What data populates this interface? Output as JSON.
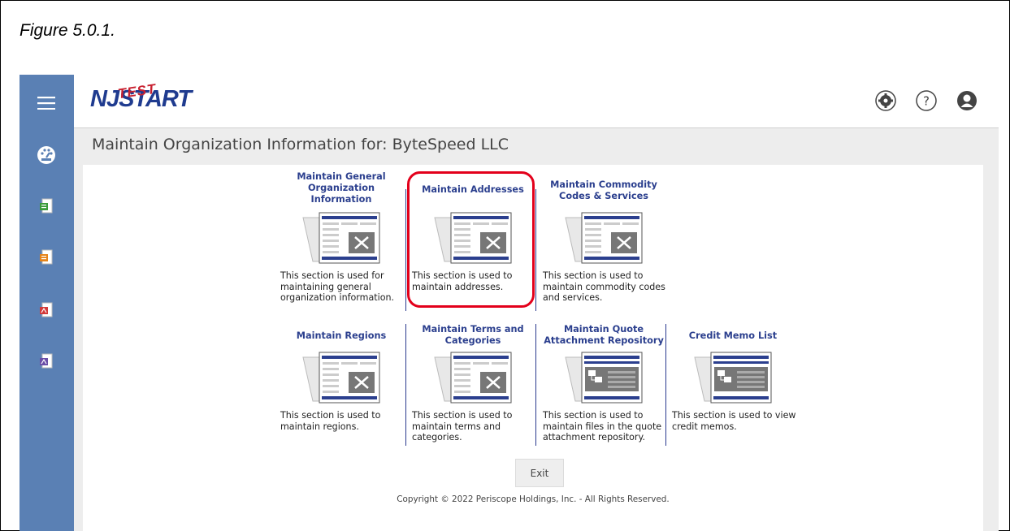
{
  "figure_caption": "Figure 5.0.1.",
  "header": {
    "logo_main": "NJSTART",
    "logo_overlay": "TEST",
    "icons": [
      "settings-icon",
      "help-icon",
      "user-icon"
    ]
  },
  "sidebar": {
    "icons": [
      "menu-icon",
      "dashboard-icon",
      "document-green-icon",
      "document-orange-icon",
      "document-red-icon",
      "document-blue-icon"
    ]
  },
  "page_title": "Maintain Organization Information for: ByteSpeed LLC",
  "tiles": [
    {
      "title": "Maintain General Organization Information",
      "desc": "This section is used for maintaining general organization information.",
      "icon": "tools-icon"
    },
    {
      "title": "Maintain Addresses",
      "desc": "This section is used to maintain addresses.",
      "icon": "tools-icon"
    },
    {
      "title": "Maintain Commodity Codes & Services",
      "desc": "This section is used to maintain commodity codes and services.",
      "icon": "tools-icon"
    },
    {
      "title": "Maintain Regions",
      "desc": "This section is used to maintain regions.",
      "icon": "tools-icon"
    },
    {
      "title": "Maintain Terms and Categories",
      "desc": "This section is used to maintain terms and categories.",
      "icon": "tools-icon"
    },
    {
      "title": "Maintain Quote Attachment Repository",
      "desc": "This section is used to maintain files in the quote attachment repository.",
      "icon": "files-icon"
    },
    {
      "title": "Credit Memo List",
      "desc": "This section is used to view credit memos.",
      "icon": "files-icon"
    }
  ],
  "exit_label": "Exit",
  "copyright": "Copyright © 2022 Periscope Holdings, Inc. - All Rights Reserved.",
  "colors": {
    "sidebar": "#5a80b4",
    "link": "#2b3f8e",
    "highlight": "#e3001b"
  }
}
